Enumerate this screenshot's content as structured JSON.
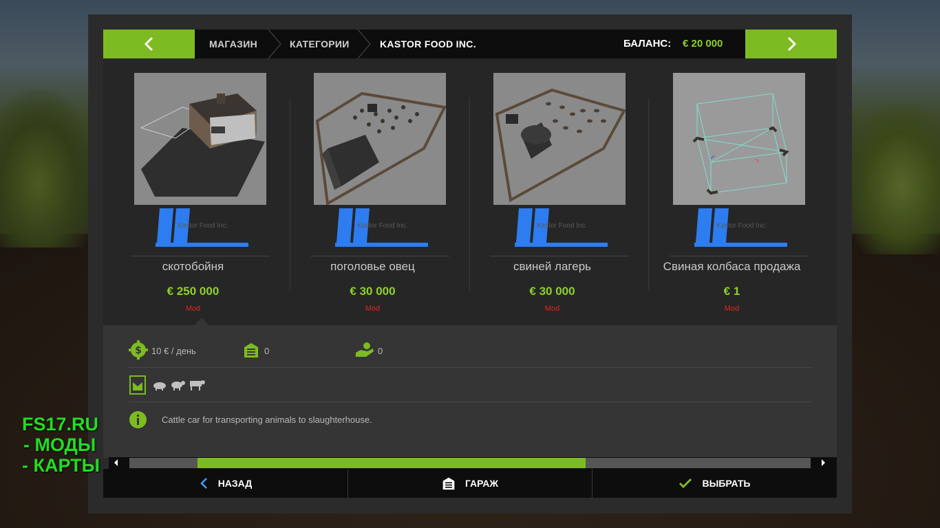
{
  "header": {
    "breadcrumbs": [
      "МАГАЗИН",
      "КАТЕГОРИИ",
      "KASTOR FOOD INC."
    ],
    "balance_label": "БАЛАНС:",
    "balance_value": "€ 20 000"
  },
  "items": [
    {
      "name": "скотобойня",
      "brand": "Kastor Food Inc.",
      "price": "€ 250 000",
      "tag": "Mod",
      "thumb": "slaughterhouse-building"
    },
    {
      "name": "поголовье овец",
      "brand": "Kastor Food Inc.",
      "price": "€ 30 000",
      "tag": "Mod",
      "thumb": "sheep-pen"
    },
    {
      "name": "свиней лагерь",
      "brand": "Kastor Food Inc.",
      "price": "€ 30 000",
      "tag": "Mod",
      "thumb": "pig-camp"
    },
    {
      "name": "Свиная колбаса продажа",
      "brand": "Kastor Food Inc.",
      "price": "€ 1",
      "tag": "Mod",
      "thumb": "sell-trigger-box"
    }
  ],
  "details": {
    "maintenance": "10 € / день",
    "storage_count": "0",
    "animal_capacity": "0",
    "description": "Cattle car for transporting animals to slaughterhouse.",
    "icons": [
      "dollar-gear-icon",
      "garage-icon",
      "hand-animal-icon",
      "feed-trough-icon",
      "pig-icon",
      "sheep-icon",
      "cow-icon",
      "info-icon"
    ]
  },
  "footer": {
    "back_label": "НАЗАД",
    "garage_label": "ГАРАЖ",
    "select_label": "ВЫБРАТЬ"
  },
  "scroll": {
    "position_fraction": 0.1,
    "visible_fraction": 0.57
  },
  "watermark": {
    "line1": "FS17.RU",
    "line2": "- МОДЫ",
    "line3": "- КАРТЫ"
  },
  "colors": {
    "accent": "#7dbb22",
    "price": "#8ed12a",
    "mod_tag": "#e0281c",
    "brand": "#2d7df0"
  }
}
